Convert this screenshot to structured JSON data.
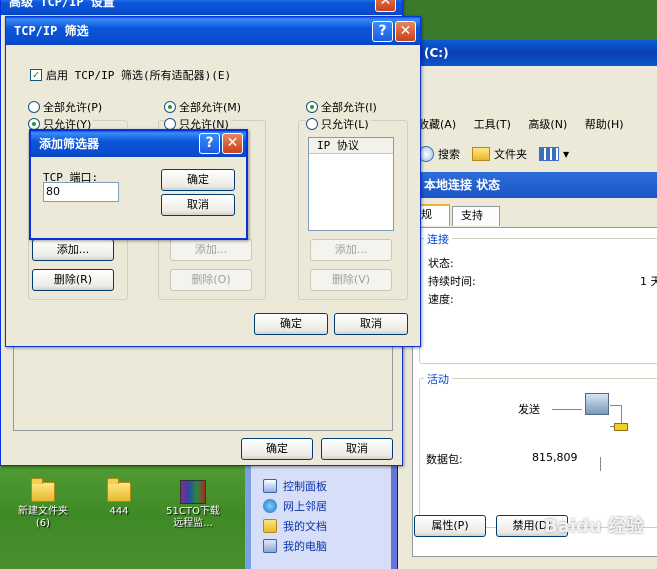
{
  "background_window": {
    "title": "高级 TCP/IP 设置",
    "ok_label": "确定",
    "cancel_label": "取消"
  },
  "explorer": {
    "title": "(C:)",
    "menu": [
      "收藏(A)",
      "工具(T)",
      "高级(N)",
      "帮助(H)"
    ],
    "toolbar": {
      "search_label": "搜索",
      "folder_label": "文件夹"
    }
  },
  "status_window": {
    "title": "本地连接 状态",
    "tabs": [
      "规",
      "支持"
    ],
    "connection_group": "连接",
    "status_label": "状态:",
    "duration_label": "持续时间:",
    "duration_value": "1 天",
    "speed_label": "速度:",
    "activity_group": "活动",
    "sent_label": "发送",
    "packets_label": "数据包:",
    "packets_value": "815,809",
    "properties_label": "属性(P)",
    "disable_label": "禁用(D)"
  },
  "watermark": "Baidu 经验",
  "taskpane": {
    "items": [
      "控制面板",
      "网上邻居",
      "我的文档",
      "我的电脑"
    ]
  },
  "desktop": {
    "icons": [
      {
        "label": "新建文件夹\n(6)",
        "kind": "folder"
      },
      {
        "label": "444",
        "kind": "folder"
      },
      {
        "label": "51CTO下载\n远程监...",
        "kind": "rar"
      }
    ]
  },
  "tcp_filter": {
    "title": "TCP/IP 筛选",
    "enable_label": "启用 TCP/IP 筛选(所有适配器)(E)",
    "enable_checked": true,
    "columns": [
      {
        "allow_all": "全部允许(P)",
        "only_allow": "只允许(Y)",
        "allow_all_selected": false,
        "add_label": "添加...",
        "remove_label": "删除(R)",
        "enabled": true
      },
      {
        "allow_all": "全部允许(M)",
        "only_allow": "只允许(N)",
        "allow_all_selected": true,
        "add_label": "添加...",
        "remove_label": "删除(O)",
        "enabled": false
      },
      {
        "allow_all": "全部允许(I)",
        "only_allow": "只允许(L)",
        "allow_all_selected": true,
        "header": "IP 协议",
        "add_label": "添加...",
        "remove_label": "删除(V)",
        "enabled": false
      }
    ],
    "ok_label": "确定",
    "cancel_label": "取消"
  },
  "add_filter": {
    "title": "添加筛选器",
    "port_label": "TCP 端口:",
    "port_value": "80",
    "ok_label": "确定",
    "cancel_label": "取消"
  }
}
